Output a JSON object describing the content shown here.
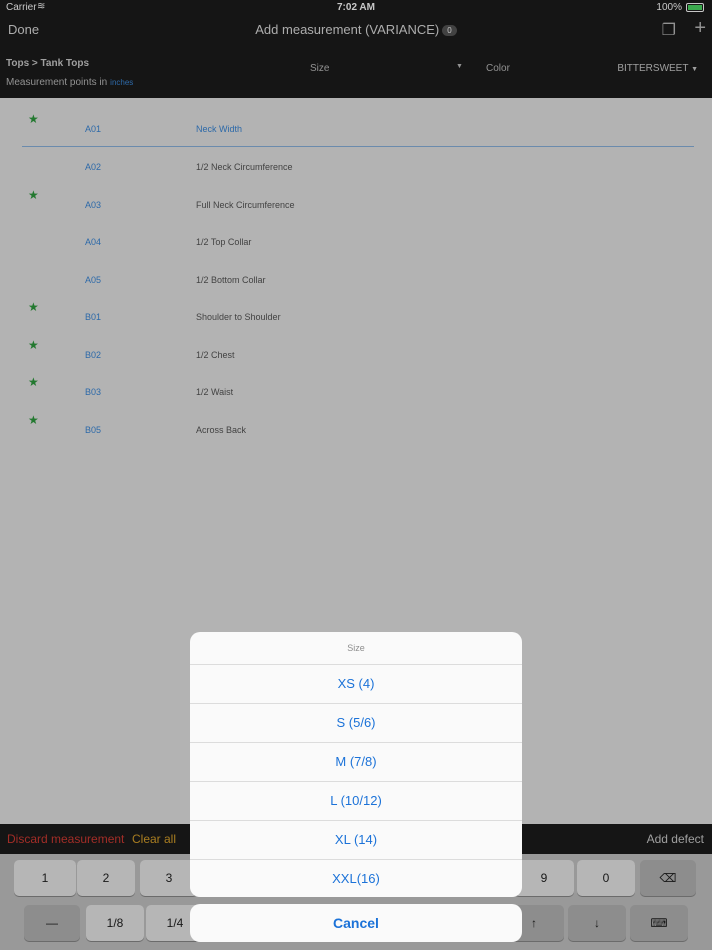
{
  "status_bar": {
    "carrier": "Carrier",
    "time": "7:02 AM",
    "battery": "100%"
  },
  "nav": {
    "done": "Done",
    "title": "Add measurement (VARIANCE)",
    "badge": "0"
  },
  "sub_header": {
    "breadcrumb": "Tops > Tank Tops",
    "points_label": "Measurement points in",
    "unit": "inches",
    "size_label": "Size",
    "color_label": "Color",
    "color_value": "BITTERSWEET"
  },
  "measurements": [
    {
      "starred": true,
      "code": "A01",
      "name": "Neck Width",
      "selected": true
    },
    {
      "starred": false,
      "code": "A02",
      "name": "1/2 Neck Circumference",
      "selected": false
    },
    {
      "starred": true,
      "code": "A03",
      "name": "Full Neck Circumference",
      "selected": false
    },
    {
      "starred": false,
      "code": "A04",
      "name": "1/2 Top Collar",
      "selected": false
    },
    {
      "starred": false,
      "code": "A05",
      "name": "1/2 Bottom Collar",
      "selected": false
    },
    {
      "starred": true,
      "code": "B01",
      "name": "Shoulder to Shoulder",
      "selected": false
    },
    {
      "starred": true,
      "code": "B02",
      "name": "1/2 Chest",
      "selected": false
    },
    {
      "starred": true,
      "code": "B03",
      "name": "1/2 Waist",
      "selected": false
    },
    {
      "starred": true,
      "code": "B05",
      "name": "Across Back",
      "selected": false
    }
  ],
  "star_glyph": "★",
  "toolbar": {
    "discard": "Discard measurement",
    "clear": "Clear all",
    "add_defect": "Add defect"
  },
  "keyboard": {
    "row1": [
      "1",
      "2",
      "3",
      "9",
      "0"
    ],
    "row2": [
      "—",
      "1/8",
      "1/4",
      "↑",
      "↓"
    ]
  },
  "size_picker": {
    "title": "Size",
    "options": [
      "XS (4)",
      "S (5/6)",
      "M (7/8)",
      "L (10/12)",
      "XL (14)",
      "XXL(16)"
    ],
    "cancel": "Cancel"
  },
  "colors": {
    "accent": "#1b72d8",
    "link": "#3a87d8",
    "star": "#2e9b3e",
    "discard": "#d03a32",
    "clear": "#d8a02a"
  }
}
